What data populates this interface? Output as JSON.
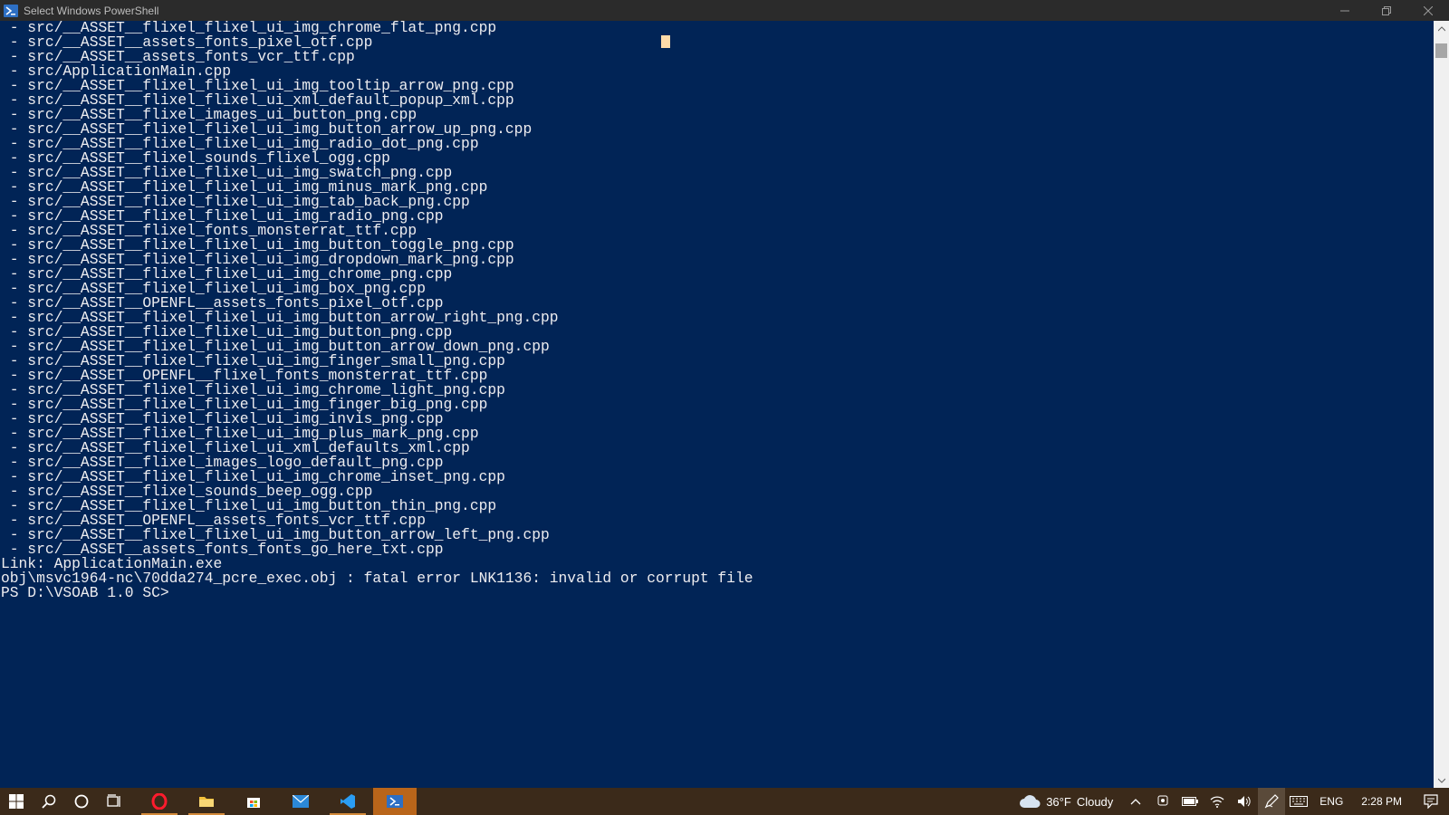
{
  "window": {
    "title": "Select Windows PowerShell"
  },
  "console": {
    "lines": [
      " - src/__ASSET__flixel_flixel_ui_img_chrome_flat_png.cpp",
      " - src/__ASSET__assets_fonts_pixel_otf.cpp",
      " - src/__ASSET__assets_fonts_vcr_ttf.cpp",
      " - src/ApplicationMain.cpp",
      " - src/__ASSET__flixel_flixel_ui_img_tooltip_arrow_png.cpp",
      " - src/__ASSET__flixel_flixel_ui_xml_default_popup_xml.cpp",
      " - src/__ASSET__flixel_images_ui_button_png.cpp",
      " - src/__ASSET__flixel_flixel_ui_img_button_arrow_up_png.cpp",
      " - src/__ASSET__flixel_flixel_ui_img_radio_dot_png.cpp",
      " - src/__ASSET__flixel_sounds_flixel_ogg.cpp",
      " - src/__ASSET__flixel_flixel_ui_img_swatch_png.cpp",
      " - src/__ASSET__flixel_flixel_ui_img_minus_mark_png.cpp",
      " - src/__ASSET__flixel_flixel_ui_img_tab_back_png.cpp",
      " - src/__ASSET__flixel_flixel_ui_img_radio_png.cpp",
      " - src/__ASSET__flixel_fonts_monsterrat_ttf.cpp",
      " - src/__ASSET__flixel_flixel_ui_img_button_toggle_png.cpp",
      " - src/__ASSET__flixel_flixel_ui_img_dropdown_mark_png.cpp",
      " - src/__ASSET__flixel_flixel_ui_img_chrome_png.cpp",
      " - src/__ASSET__flixel_flixel_ui_img_box_png.cpp",
      " - src/__ASSET__OPENFL__assets_fonts_pixel_otf.cpp",
      " - src/__ASSET__flixel_flixel_ui_img_button_arrow_right_png.cpp",
      " - src/__ASSET__flixel_flixel_ui_img_button_png.cpp",
      " - src/__ASSET__flixel_flixel_ui_img_button_arrow_down_png.cpp",
      " - src/__ASSET__flixel_flixel_ui_img_finger_small_png.cpp",
      " - src/__ASSET__OPENFL__flixel_fonts_monsterrat_ttf.cpp",
      " - src/__ASSET__flixel_flixel_ui_img_chrome_light_png.cpp",
      " - src/__ASSET__flixel_flixel_ui_img_finger_big_png.cpp",
      " - src/__ASSET__flixel_flixel_ui_img_invis_png.cpp",
      " - src/__ASSET__flixel_flixel_ui_img_plus_mark_png.cpp",
      " - src/__ASSET__flixel_flixel_ui_xml_defaults_xml.cpp",
      " - src/__ASSET__flixel_images_logo_default_png.cpp",
      " - src/__ASSET__flixel_flixel_ui_img_chrome_inset_png.cpp",
      " - src/__ASSET__flixel_sounds_beep_ogg.cpp",
      " - src/__ASSET__flixel_flixel_ui_img_button_thin_png.cpp",
      " - src/__ASSET__OPENFL__assets_fonts_vcr_ttf.cpp",
      " - src/__ASSET__flixel_flixel_ui_img_button_arrow_left_png.cpp",
      " - src/__ASSET__assets_fonts_fonts_go_here_txt.cpp",
      "Link: ApplicationMain.exe",
      "obj\\msvc1964-nc\\70dda274_pcre_exec.obj : fatal error LNK1136: invalid or corrupt file",
      "PS D:\\VSOAB 1.0 SC>"
    ]
  },
  "taskbar": {
    "weather": {
      "temp": "36°F",
      "condition": "Cloudy"
    },
    "language": "ENG",
    "time": "2:28 PM"
  },
  "colors": {
    "console_bg": "#012456",
    "console_fg": "#eeedf0",
    "titlebar_bg": "#2b2b2b",
    "taskbar_bg": "#3b2a1a",
    "taskbar_active": "#b9651a"
  }
}
